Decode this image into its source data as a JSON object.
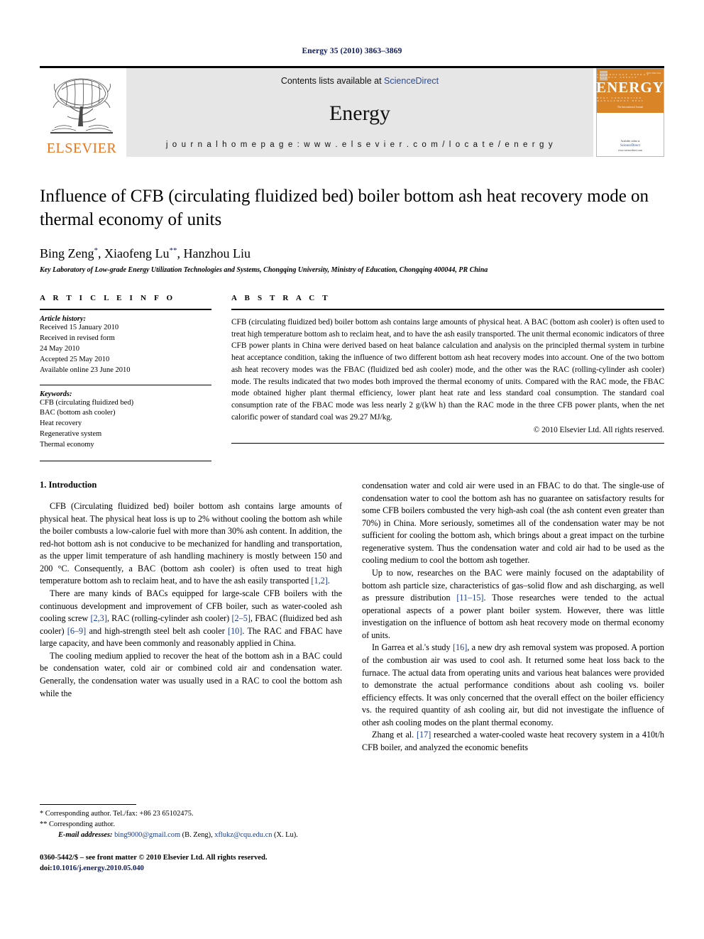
{
  "running_head": "Energy 35 (2010) 3863–3869",
  "masthead": {
    "publisher_name": "ELSEVIER",
    "contents_prefix": "Contents lists available at ",
    "contents_link": "ScienceDirect",
    "journal_name": "Energy",
    "homepage_line": "j o u r n a l   h o m e p a g e :   w w w . e l s e v i e r . c o m / l o c a t e / e n e r g y",
    "cover": {
      "top_line": "TECHNOLOGY        ENERGY        SCIENCE        SUPPLY",
      "title": "ENERGY",
      "bottom_line": "HEAT        CONVERSION        MANAGEMENT        HEAT",
      "subtitle": "The International Journal",
      "issn": "ISSN 0360-5442",
      "footer_top": "Available online at",
      "footer_brand": "ScienceDirect",
      "footer_url": "www.sciencedirect.com"
    }
  },
  "article": {
    "title": "Influence of CFB (circulating fluidized bed) boiler bottom ash heat recovery mode on thermal economy of units",
    "authors_parts": [
      {
        "name": "Bing Zeng",
        "mark": "*"
      },
      {
        "name": ", Xiaofeng Lu",
        "mark": "**"
      },
      {
        "name": ", Hanzhou Liu",
        "mark": ""
      }
    ],
    "affiliation": "Key Laboratory of Low-grade Energy Utilization Technologies and Systems, Chongqing University, Ministry of Education, Chongqing 400044, PR China"
  },
  "article_info": {
    "heading": "A R T I C L E  I N F O",
    "history_label": "Article history:",
    "history": [
      "Received 15 January 2010",
      "Received in revised form",
      "24 May 2010",
      "Accepted 25 May 2010",
      "Available online 23 June 2010"
    ],
    "keywords_label": "Keywords:",
    "keywords": [
      "CFB (circulating fluidized bed)",
      "BAC (bottom ash cooler)",
      "Heat recovery",
      "Regenerative system",
      "Thermal economy"
    ]
  },
  "abstract": {
    "heading": "A B S T R A C T",
    "text": "CFB (circulating fluidized bed) boiler bottom ash contains large amounts of physical heat. A BAC (bottom ash cooler) is often used to treat high temperature bottom ash to reclaim heat, and to have the ash easily transported. The unit thermal economic indicators of three CFB power plants in China were derived based on heat balance calculation and analysis on the principled thermal system in turbine heat acceptance condition, taking the influence of two different bottom ash heat recovery modes into account. One of the two bottom ash heat recovery modes was the FBAC (fluidized bed ash cooler) mode, and the other was the RAC (rolling-cylinder ash cooler) mode. The results indicated that two modes both improved the thermal economy of units. Compared with the RAC mode, the FBAC mode obtained higher plant thermal efficiency, lower plant heat rate and less standard coal consumption. The standard coal consumption rate of the FBAC mode was less nearly 2 g/(kW h) than the RAC mode in the three CFB power plants, when the net calorific power of standard coal was 29.27 MJ/kg.",
    "copyright": "© 2010 Elsevier Ltd. All rights reserved."
  },
  "body": {
    "section_title": "1. Introduction",
    "left_paragraphs": [
      "CFB (Circulating fluidized bed) boiler bottom ash contains large amounts of physical heat. The physical heat loss is up to 2% without cooling the bottom ash while the boiler combusts a low-calorie fuel with more than 30% ash content. In addition, the red-hot bottom ash is not conducive to be mechanized for handling and transportation, as the upper limit temperature of ash handling machinery is mostly between 150 and 200 °C. Consequently, a BAC (bottom ash cooler) is often used to treat high temperature bottom ash to reclaim heat, and to have the ash easily transported [1,2].",
      "There are many kinds of BACs equipped for large-scale CFB boilers with the continuous development and improvement of CFB boiler, such as water-cooled ash cooling screw [2,3], RAC (rolling-cylinder ash cooler) [2–5], FBAC (fluidized bed ash cooler) [6–9] and high-strength steel belt ash cooler [10]. The RAC and FBAC have large capacity, and have been commonly and reasonably applied in China.",
      "The cooling medium applied to recover the heat of the bottom ash in a BAC could be condensation water, cold air or combined cold air and condensation water. Generally, the condensation water was usually used in a RAC to cool the bottom ash while the"
    ],
    "right_paragraphs": [
      "condensation water and cold air were used in an FBAC to do that. The single-use of condensation water to cool the bottom ash has no guarantee on satisfactory results for some CFB boilers combusted the very high-ash coal (the ash content even greater than 70%) in China. More seriously, sometimes all of the condensation water may be not sufficient for cooling the bottom ash, which brings about a great impact on the turbine regenerative system. Thus the condensation water and cold air had to be used as the cooling medium to cool the bottom ash together.",
      "Up to now, researches on the BAC were mainly focused on the adaptability of bottom ash particle size, characteristics of gas–solid flow and ash discharging, as well as pressure distribution [11–15]. Those researches were tended to the actual operational aspects of a power plant boiler system. However, there was little investigation on the influence of bottom ash heat recovery mode on thermal economy of units.",
      "In Garrea et al.'s study [16], a new dry ash removal system was proposed. A portion of the combustion air was used to cool ash. It returned some heat loss back to the furnace. The actual data from operating units and various heat balances were provided to demonstrate the actual performance conditions about ash cooling vs. boiler efficiency effects. It was only concerned that the overall effect on the boiler efficiency vs. the required quantity of ash cooling air, but did not investigate the influence of other ash cooling modes on the plant thermal economy.",
      "Zhang et al. [17] researched a water-cooled waste heat recovery system in a 410t/h CFB boiler, and analyzed the economic benefits"
    ]
  },
  "footnotes": {
    "corresponding_1": "* Corresponding author. Tel./fax: +86 23 65102475.",
    "corresponding_2": "** Corresponding author.",
    "email_label": "E-mail addresses:",
    "email_1": "bing9000@gmail.com",
    "email_1_owner": " (B. Zeng), ",
    "email_2": "xflukz@cqu.edu.cn",
    "email_2_owner": " (X. Lu)."
  },
  "imprint": {
    "issn_line": "0360-5442/$ – see front matter © 2010 Elsevier Ltd. All rights reserved.",
    "doi_label": "doi:",
    "doi_value": "10.1016/j.energy.2010.05.040"
  },
  "colors": {
    "link_blue": "#1a3a8f",
    "elsevier_orange": "#E87722",
    "band_gray": "#e6e6e6",
    "running_head_navy": "#0d1a5c"
  }
}
